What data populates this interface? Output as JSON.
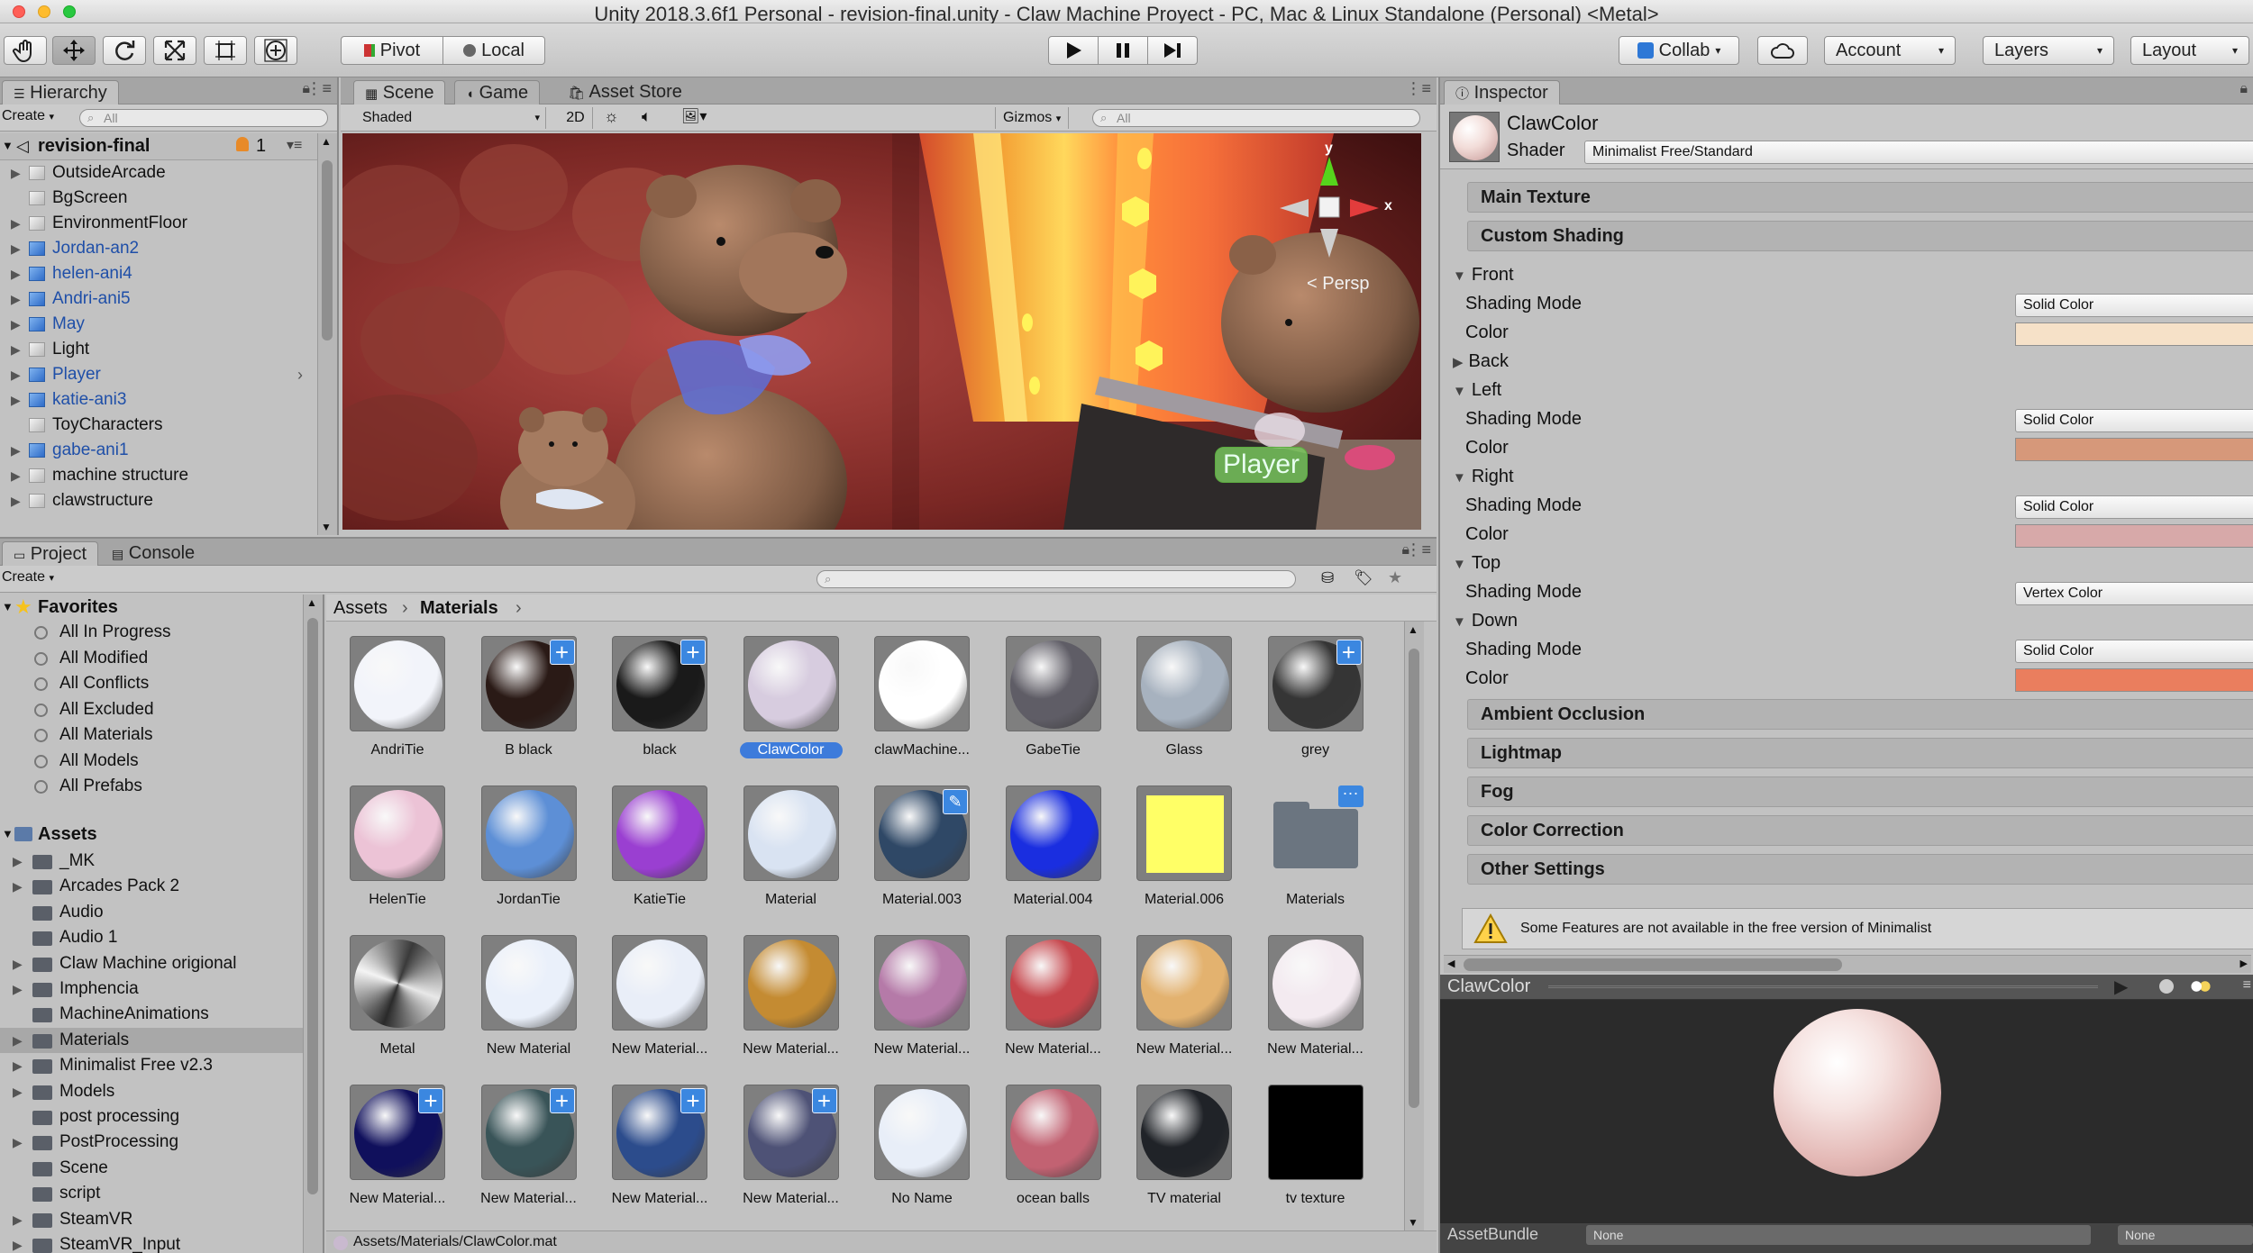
{
  "window": {
    "title": "Unity 2018.3.6f1 Personal - revision-final.unity - Claw Machine Proyect - PC, Mac & Linux Standalone (Personal) <Metal>"
  },
  "toolbar": {
    "pivot": "Pivot",
    "local": "Local",
    "collab": "Collab",
    "account": "Account",
    "layers": "Layers",
    "layout": "Layout"
  },
  "hierarchy": {
    "tab": "Hierarchy",
    "create": "Create",
    "search_placeholder": "All",
    "scene_name": "revision-final",
    "scene_badge": "1",
    "items": [
      {
        "label": "OutsideArcade",
        "prefab": false,
        "arrow": true
      },
      {
        "label": "BgScreen",
        "prefab": false,
        "arrow": false
      },
      {
        "label": "EnvironmentFloor",
        "prefab": false,
        "arrow": true
      },
      {
        "label": "Jordan-an2",
        "prefab": true,
        "arrow": true
      },
      {
        "label": "helen-ani4",
        "prefab": true,
        "arrow": true
      },
      {
        "label": "Andri-ani5",
        "prefab": true,
        "arrow": true
      },
      {
        "label": "May",
        "prefab": true,
        "arrow": true
      },
      {
        "label": "Light",
        "prefab": false,
        "arrow": true
      },
      {
        "label": "Player",
        "prefab": true,
        "arrow": true
      },
      {
        "label": "katie-ani3",
        "prefab": true,
        "arrow": true
      },
      {
        "label": "ToyCharacters",
        "prefab": false,
        "arrow": false
      },
      {
        "label": "gabe-ani1",
        "prefab": true,
        "arrow": true
      },
      {
        "label": "machine structure",
        "prefab": false,
        "arrow": true
      },
      {
        "label": "clawstructure",
        "prefab": false,
        "arrow": true
      }
    ]
  },
  "scene": {
    "tabs": [
      "Scene",
      "Game",
      "Asset Store"
    ],
    "shaded": "Shaded",
    "mode_2d": "2D",
    "gizmos": "Gizmos",
    "search_placeholder": "All",
    "persp": "< Persp",
    "player_label": "Player",
    "axis_x": "x",
    "axis_y": "y"
  },
  "project": {
    "tabs": [
      "Project",
      "Console"
    ],
    "create": "Create",
    "favorites_label": "Favorites",
    "favorites": [
      "All In Progress",
      "All Modified",
      "All Conflicts",
      "All Excluded",
      "All Materials",
      "All Models",
      "All Prefabs"
    ],
    "assets_label": "Assets",
    "folders": [
      {
        "label": "_MK",
        "arrow": true
      },
      {
        "label": "Arcades Pack 2",
        "arrow": true
      },
      {
        "label": "Audio",
        "arrow": false
      },
      {
        "label": "Audio 1",
        "arrow": false
      },
      {
        "label": "Claw Machine origional",
        "arrow": true
      },
      {
        "label": "Imphencia",
        "arrow": true
      },
      {
        "label": "MachineAnimations",
        "arrow": false
      },
      {
        "label": "Materials",
        "arrow": true
      },
      {
        "label": "Minimalist Free v2.3",
        "arrow": true
      },
      {
        "label": "Models",
        "arrow": true
      },
      {
        "label": "post processing",
        "arrow": false
      },
      {
        "label": "PostProcessing",
        "arrow": true
      },
      {
        "label": "Scene",
        "arrow": false
      },
      {
        "label": "script",
        "arrow": false
      },
      {
        "label": "SteamVR",
        "arrow": true
      },
      {
        "label": "SteamVR_Input",
        "arrow": true
      }
    ],
    "breadcrumb": [
      "Assets",
      "Materials"
    ],
    "path_bar": "Assets/Materials/ClawColor.mat",
    "materials": [
      {
        "name": "AndriTie",
        "color": "#f2f4fa",
        "badge": false
      },
      {
        "name": "B black",
        "color": "#2a1a16",
        "badge": true
      },
      {
        "name": "black",
        "color": "#1a1a1a",
        "badge": true
      },
      {
        "name": "ClawColor",
        "color": "#d7ccdf",
        "badge": false,
        "selected": true
      },
      {
        "name": "clawMachine...",
        "color": "#ffffff",
        "badge": false
      },
      {
        "name": "GabeTie",
        "color": "#5f5d66",
        "badge": false
      },
      {
        "name": "Glass",
        "color": "#a7b2bf",
        "badge": false
      },
      {
        "name": "grey",
        "color": "#353535",
        "badge": true
      },
      {
        "name": "HelenTie",
        "color": "#ecc3d6",
        "badge": false
      },
      {
        "name": "JordanTie",
        "color": "#5d8fd6",
        "badge": false
      },
      {
        "name": "KatieTie",
        "color": "#9a3fd1",
        "badge": false
      },
      {
        "name": "Material",
        "color": "#d9e3f2",
        "badge": false
      },
      {
        "name": "Material.003",
        "color": "#2f4866",
        "badge": false,
        "edit": true
      },
      {
        "name": "Material.004",
        "color": "#1a2ee0",
        "badge": false
      },
      {
        "name": "Material.006",
        "color": "#ffff66",
        "badge": false,
        "flat": true
      },
      {
        "name": "Materials",
        "color": "#6b7580",
        "badge": false,
        "folder": true
      },
      {
        "name": "Metal",
        "color": "#8a8a8a",
        "badge": false,
        "metal": true
      },
      {
        "name": "New Material",
        "color": "#eaf0fa",
        "badge": false
      },
      {
        "name": "New Material...",
        "color": "#e9eef8",
        "badge": false
      },
      {
        "name": "New Material...",
        "color": "#c48b32",
        "badge": false
      },
      {
        "name": "New Material...",
        "color": "#b57aa8",
        "badge": false
      },
      {
        "name": "New Material...",
        "color": "#c6454b",
        "badge": false
      },
      {
        "name": "New Material...",
        "color": "#e3b26f",
        "badge": false
      },
      {
        "name": "New Material...",
        "color": "#f3eaf0",
        "badge": false
      },
      {
        "name": "New Material...",
        "color": "#10105c",
        "badge": true
      },
      {
        "name": "New Material...",
        "color": "#395458",
        "badge": true
      },
      {
        "name": "New Material...",
        "color": "#2c4c8c",
        "badge": true
      },
      {
        "name": "New Material...",
        "color": "#4e5276",
        "badge": true
      },
      {
        "name": "No Name",
        "color": "#e8eef8",
        "badge": false
      },
      {
        "name": "ocean balls",
        "color": "#c26272",
        "badge": false
      },
      {
        "name": "TV material",
        "color": "#202328",
        "badge": false
      },
      {
        "name": "tv texture",
        "color": "#000000",
        "badge": false,
        "flat": true
      }
    ]
  },
  "inspector": {
    "tab": "Inspector",
    "material_name": "ClawColor",
    "shader_label": "Shader",
    "shader_value": "Minimalist Free/Standard",
    "sections_top": [
      "Main Texture",
      "Custom Shading"
    ],
    "faces": [
      {
        "label": "Front",
        "expanded": true,
        "mode": "Solid Color",
        "color": "#f6e1c8"
      },
      {
        "label": "Back",
        "expanded": false
      },
      {
        "label": "Left",
        "expanded": true,
        "mode": "Solid Color",
        "color": "#d6987a"
      },
      {
        "label": "Right",
        "expanded": true,
        "mode": "Solid Color",
        "color": "#d7a9a9"
      },
      {
        "label": "Top",
        "expanded": true,
        "mode": "Vertex Color"
      },
      {
        "label": "Down",
        "expanded": true,
        "mode": "Solid Color",
        "color": "#ea7e5e"
      }
    ],
    "shading_mode_label": "Shading Mode",
    "color_label": "Color",
    "sections_bottom": [
      "Ambient Occlusion",
      "Lightmap",
      "Fog",
      "Color Correction",
      "Other Settings"
    ],
    "warning": "Some Features are not available in the free version of Minimalist",
    "preview_title": "ClawColor",
    "assetbundle_label": "AssetBundle",
    "assetbundle_value": "None",
    "assetbundle_variant": "None"
  }
}
